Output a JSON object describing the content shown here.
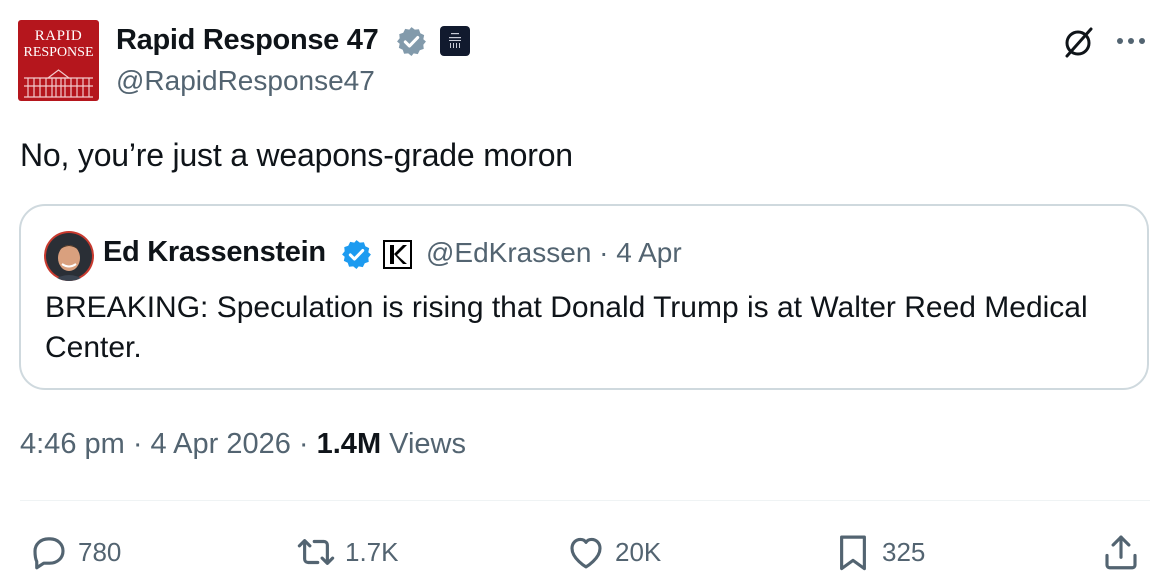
{
  "author": {
    "display_name": "Rapid Response 47",
    "handle": "@RapidResponse47",
    "avatar_text_line1": "RAPID",
    "avatar_text_line2": "RESPONSE",
    "verified_color": "#829aab",
    "brand_color": "#b5161d"
  },
  "tweet": {
    "text": "No, you’re just a weapons-grade moron"
  },
  "quoted_tweet": {
    "display_name": "Ed Krassenstein",
    "handle_and_date": "@EdKrassen · 4 Apr",
    "text": "BREAKING: Speculation is rising that Donald Trump is at Walter Reed Medical Center.",
    "verified_color": "#1d9bf0"
  },
  "meta": {
    "time_and_date": "4:46 pm · 4 Apr 2026 · ",
    "views_count": "1.4M",
    "views_label": " Views"
  },
  "actions": {
    "replies": "780",
    "reposts": "1.7K",
    "likes": "20K",
    "bookmarks": "325"
  },
  "icons": [
    "verified-badge-icon",
    "affiliate-badge-icon",
    "grok-icon",
    "more-icon",
    "reply-icon",
    "repost-icon",
    "like-icon",
    "bookmark-icon",
    "share-icon"
  ]
}
